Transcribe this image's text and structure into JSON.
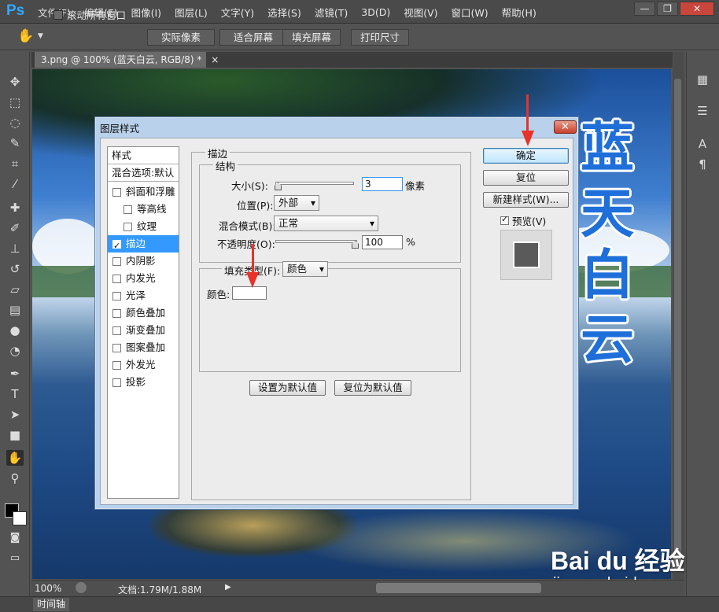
{
  "app": {
    "logo": "Ps",
    "menu": [
      "文件(F)",
      "编辑(E)",
      "图像(I)",
      "图层(L)",
      "文字(Y)",
      "选择(S)",
      "滤镜(T)",
      "3D(D)",
      "视图(V)",
      "窗口(W)",
      "帮助(H)"
    ],
    "window_controls": {
      "minimize": "—",
      "restore": "❐",
      "close": "✕"
    }
  },
  "options_bar": {
    "scroll_all_label": "滚动所有窗口",
    "buttons": [
      "实际像素",
      "适合屏幕",
      "填充屏幕",
      "打印尺寸"
    ]
  },
  "document": {
    "tab_title": "3.png @ 100% (蓝天白云, RGB/8) *",
    "tab_close": "×",
    "canvas_text": [
      "蓝",
      "天",
      "白",
      "云"
    ]
  },
  "status_bar": {
    "zoom": "100%",
    "doc_info": "文档:1.79M/1.88M"
  },
  "timeline_tab": "时间轴",
  "dialog": {
    "title": "图层样式",
    "close": "✕",
    "style_list": {
      "header": "样式",
      "blending_options": "混合选项:默认",
      "items": [
        {
          "label": "斜面和浮雕",
          "checked": false,
          "indent": false
        },
        {
          "label": "等高线",
          "checked": false,
          "indent": true
        },
        {
          "label": "纹理",
          "checked": false,
          "indent": true
        },
        {
          "label": "描边",
          "checked": true,
          "indent": false,
          "selected": true
        },
        {
          "label": "内阴影",
          "checked": false,
          "indent": false
        },
        {
          "label": "内发光",
          "checked": false,
          "indent": false
        },
        {
          "label": "光泽",
          "checked": false,
          "indent": false
        },
        {
          "label": "颜色叠加",
          "checked": false,
          "indent": false
        },
        {
          "label": "渐变叠加",
          "checked": false,
          "indent": false
        },
        {
          "label": "图案叠加",
          "checked": false,
          "indent": false
        },
        {
          "label": "外发光",
          "checked": false,
          "indent": false
        },
        {
          "label": "投影",
          "checked": false,
          "indent": false
        }
      ]
    },
    "stroke": {
      "group_title": "描边",
      "structure_title": "结构",
      "size_label": "大小(S):",
      "size_value": "3",
      "size_unit": "像素",
      "position_label": "位置(P):",
      "position_value": "外部",
      "blend_label": "混合模式(B):",
      "blend_value": "正常",
      "opacity_label": "不透明度(O):",
      "opacity_value": "100",
      "opacity_unit": "%",
      "fill_type_label": "填充类型(F):",
      "fill_type_value": "颜色",
      "color_label": "颜色:",
      "color_value": "#ffffff",
      "make_default": "设置为默认值",
      "reset_default": "复位为默认值"
    },
    "buttons": {
      "ok": "确定",
      "reset": "复位",
      "new_style": "新建样式(W)...",
      "preview_label": "预览(V)",
      "preview_checked": true
    }
  },
  "watermark": {
    "logo": "Bai du 经验",
    "url": "jingyan.baidu.com"
  },
  "colors": {
    "accent_blue": "#1e6fd9",
    "selection": "#3399ff",
    "arrow_red": "#e8322b"
  }
}
